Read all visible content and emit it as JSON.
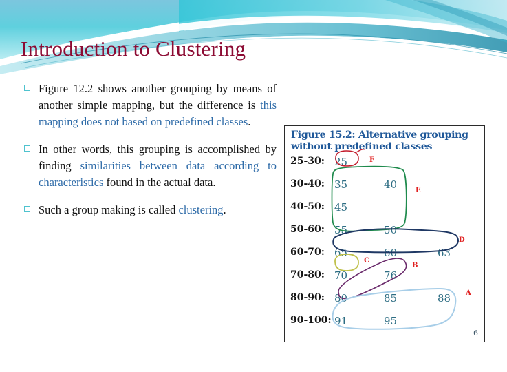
{
  "slide": {
    "title": "Introduction to Clustering",
    "title_color": "#8C0B33",
    "accent_color": "#2E6BA8",
    "header_teal": "#5BC8D8",
    "bullet_marker_color": "#4FC3CF"
  },
  "bullets": [
    {
      "black_before": "Figure 12.2 shows another grouping by means of another simple mapping, but the difference is ",
      "blue": "this mapping does not based on predefined classes",
      "black_after": "."
    },
    {
      "black_before": "In other words, this grouping is accomplished by finding ",
      "blue": "similarities between data according to characteristics",
      "black_after": " found in the actual data."
    },
    {
      "black_before": "Such a group making is called ",
      "blue": "clustering",
      "black_after": "."
    }
  ],
  "figure": {
    "caption": "Figure 15.2: Alternative grouping without predefined classes",
    "page_number": "6",
    "caption_color": "#1F5899",
    "value_color": "#2D6D83",
    "cluster_label_color": "#E02020",
    "rows": [
      {
        "label": "25-30:",
        "values": [
          "25"
        ]
      },
      {
        "label": "30-40:",
        "values": [
          "35",
          "40"
        ]
      },
      {
        "label": "40-50:",
        "values": [
          "45"
        ]
      },
      {
        "label": "50-60:",
        "values": [
          "55",
          "50"
        ]
      },
      {
        "label": "60-70:",
        "values": [
          "65",
          "60",
          "63"
        ]
      },
      {
        "label": "70-80:",
        "values": [
          "70",
          "76"
        ]
      },
      {
        "label": "80-90:",
        "values": [
          "80",
          "85",
          "88"
        ]
      },
      {
        "label": "90-100:",
        "values": [
          "91",
          "95"
        ]
      }
    ],
    "cluster_labels": [
      {
        "name": "F",
        "color": "#E02020"
      },
      {
        "name": "E",
        "color": "#E02020"
      },
      {
        "name": "D",
        "color": "#E02020"
      },
      {
        "name": "C",
        "color": "#E02020"
      },
      {
        "name": "B",
        "color": "#E02020"
      },
      {
        "name": "A",
        "color": "#E02020"
      }
    ],
    "cluster_ring_colors": {
      "F": "#C21B2B",
      "E": "#1E8A4C",
      "D": "#1F3864",
      "C": "#BFC04A",
      "B": "#6A2A6B",
      "A": "#A8CEE8"
    }
  },
  "chart_data": {
    "type": "table",
    "title": "Figure 15.2: Alternative grouping without predefined classes",
    "categories": [
      "25-30",
      "30-40",
      "40-50",
      "50-60",
      "60-70",
      "70-80",
      "80-90",
      "90-100"
    ],
    "values": [
      [
        25
      ],
      [
        35,
        40
      ],
      [
        45
      ],
      [
        55,
        50
      ],
      [
        65,
        60,
        63
      ],
      [
        70,
        76
      ],
      [
        80,
        85,
        88
      ],
      [
        91,
        95
      ]
    ],
    "annotations": [
      "F",
      "E",
      "D",
      "C",
      "B",
      "A"
    ]
  }
}
